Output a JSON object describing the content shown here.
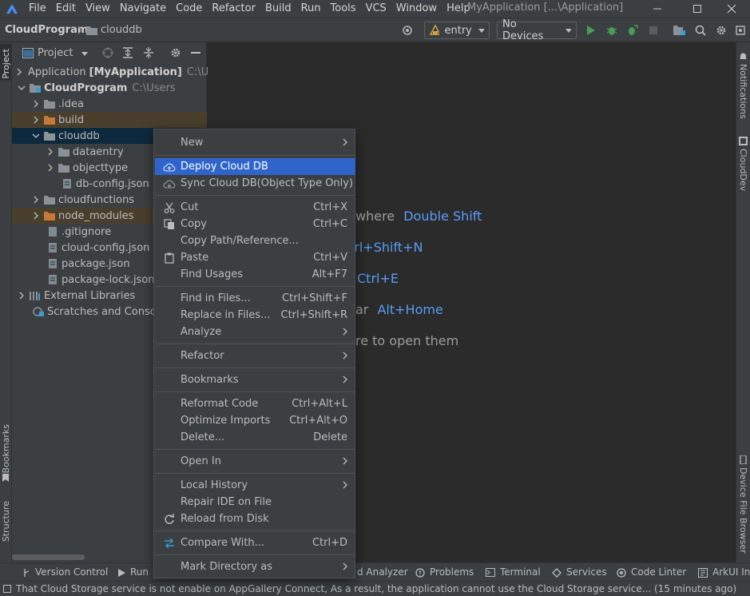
{
  "menubar": {
    "items": [
      "File",
      "Edit",
      "View",
      "Navigate",
      "Code",
      "Refactor",
      "Build",
      "Run",
      "Tools",
      "VCS",
      "Window",
      "Help"
    ],
    "window_title": "MyApplication [...\\Application]"
  },
  "navbar": {
    "breadcrumb_root": "CloudProgram",
    "breadcrumb_child": "clouddb",
    "run_config": "entry",
    "device": "No Devices"
  },
  "left_stripe": {
    "project": "Project",
    "bookmarks": "Bookmarks",
    "structure": "Structure"
  },
  "right_stripe": {
    "notifications": "Notifications",
    "clouddev": "CloudDev",
    "device_file_browser": "Device File Browser"
  },
  "project_panel": {
    "view_mode": "Project",
    "tree": [
      {
        "label": "Application",
        "bold": "[MyApplication]",
        "path": "C:\\U"
      },
      {
        "label": "CloudProgram",
        "path": "C:\\Users"
      },
      {
        "label": ".idea"
      },
      {
        "label": "build"
      },
      {
        "label": "clouddb"
      },
      {
        "label": "dataentry"
      },
      {
        "label": "objecttype"
      },
      {
        "label": "db-config.json"
      },
      {
        "label": "cloudfunctions"
      },
      {
        "label": "node_modules"
      },
      {
        "label": ".gitignore"
      },
      {
        "label": "cloud-config.json"
      },
      {
        "label": "package.json"
      },
      {
        "label": "package-lock.json"
      },
      {
        "label": "External Libraries"
      },
      {
        "label": "Scratches and Consoles"
      }
    ]
  },
  "editor_tips": [
    {
      "text": "where",
      "key": "Double Shift"
    },
    {
      "text": "trl+Shift+N",
      "key": ""
    },
    {
      "text": "",
      "key": "Ctrl+E"
    },
    {
      "text": "ar",
      "key": "Alt+Home"
    },
    {
      "text": "re to open them",
      "key": ""
    }
  ],
  "context_menu": {
    "items": [
      {
        "label": "New",
        "shortcut": ""
      },
      {
        "label": "Deploy Cloud DB",
        "shortcut": ""
      },
      {
        "label": "Sync Cloud DB(Object Type Only)",
        "shortcut": ""
      },
      {
        "label": "Cut",
        "shortcut": "Ctrl+X"
      },
      {
        "label": "Copy",
        "shortcut": "Ctrl+C"
      },
      {
        "label": "Copy Path/Reference...",
        "shortcut": ""
      },
      {
        "label": "Paste",
        "shortcut": "Ctrl+V"
      },
      {
        "label": "Find Usages",
        "shortcut": "Alt+F7"
      },
      {
        "label": "Find in Files...",
        "shortcut": "Ctrl+Shift+F"
      },
      {
        "label": "Replace in Files...",
        "shortcut": "Ctrl+Shift+R"
      },
      {
        "label": "Analyze",
        "shortcut": ""
      },
      {
        "label": "Refactor",
        "shortcut": ""
      },
      {
        "label": "Bookmarks",
        "shortcut": ""
      },
      {
        "label": "Reformat Code",
        "shortcut": "Ctrl+Alt+L"
      },
      {
        "label": "Optimize Imports",
        "shortcut": "Ctrl+Alt+O"
      },
      {
        "label": "Delete...",
        "shortcut": "Delete"
      },
      {
        "label": "Open In",
        "shortcut": ""
      },
      {
        "label": "Local History",
        "shortcut": ""
      },
      {
        "label": "Repair IDE on File",
        "shortcut": ""
      },
      {
        "label": "Reload from Disk",
        "shortcut": ""
      },
      {
        "label": "Compare With...",
        "shortcut": "Ctrl+D"
      },
      {
        "label": "Mark Directory as",
        "shortcut": ""
      }
    ]
  },
  "bottom_toolbar": {
    "version_control": "Version Control",
    "run": "Run",
    "analyzer": "d Analyzer",
    "problems": "Problems",
    "terminal": "Terminal",
    "services": "Services",
    "code_linter": "Code Linter",
    "arkui": "ArkUI Ins"
  },
  "status_bar": {
    "message": "That Cloud Storage service is not enable on AppGallery Connect, As a result, the application cannot use the Cloud Storage service... (15 minutes ago)"
  },
  "colors": {
    "highlight": "#2f65ca",
    "link_key": "#589df6",
    "run_green": "#499c54",
    "excluded_folder": "#c6773a"
  }
}
